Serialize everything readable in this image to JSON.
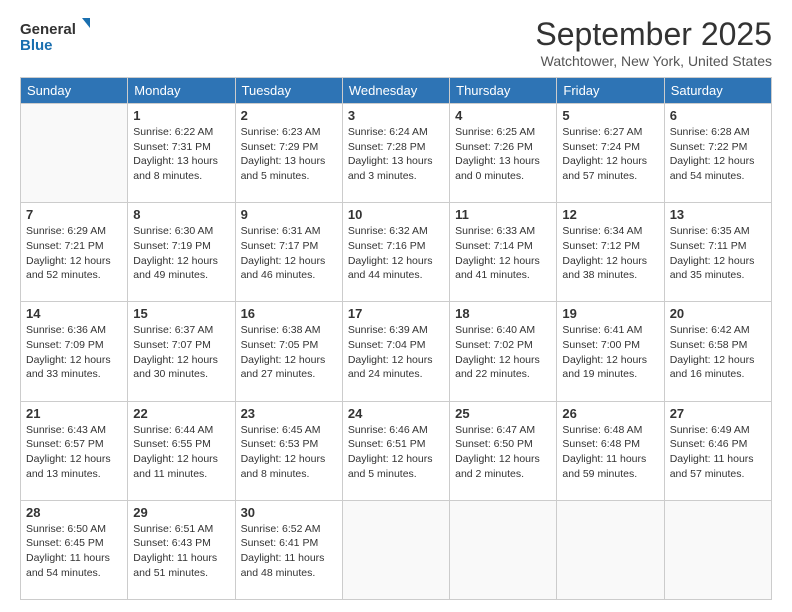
{
  "logo": {
    "general": "General",
    "blue": "Blue"
  },
  "header": {
    "month": "September 2025",
    "location": "Watchtower, New York, United States"
  },
  "weekdays": [
    "Sunday",
    "Monday",
    "Tuesday",
    "Wednesday",
    "Thursday",
    "Friday",
    "Saturday"
  ],
  "weeks": [
    [
      {
        "day": "",
        "info": ""
      },
      {
        "day": "1",
        "info": "Sunrise: 6:22 AM\nSunset: 7:31 PM\nDaylight: 13 hours\nand 8 minutes."
      },
      {
        "day": "2",
        "info": "Sunrise: 6:23 AM\nSunset: 7:29 PM\nDaylight: 13 hours\nand 5 minutes."
      },
      {
        "day": "3",
        "info": "Sunrise: 6:24 AM\nSunset: 7:28 PM\nDaylight: 13 hours\nand 3 minutes."
      },
      {
        "day": "4",
        "info": "Sunrise: 6:25 AM\nSunset: 7:26 PM\nDaylight: 13 hours\nand 0 minutes."
      },
      {
        "day": "5",
        "info": "Sunrise: 6:27 AM\nSunset: 7:24 PM\nDaylight: 12 hours\nand 57 minutes."
      },
      {
        "day": "6",
        "info": "Sunrise: 6:28 AM\nSunset: 7:22 PM\nDaylight: 12 hours\nand 54 minutes."
      }
    ],
    [
      {
        "day": "7",
        "info": "Sunrise: 6:29 AM\nSunset: 7:21 PM\nDaylight: 12 hours\nand 52 minutes."
      },
      {
        "day": "8",
        "info": "Sunrise: 6:30 AM\nSunset: 7:19 PM\nDaylight: 12 hours\nand 49 minutes."
      },
      {
        "day": "9",
        "info": "Sunrise: 6:31 AM\nSunset: 7:17 PM\nDaylight: 12 hours\nand 46 minutes."
      },
      {
        "day": "10",
        "info": "Sunrise: 6:32 AM\nSunset: 7:16 PM\nDaylight: 12 hours\nand 44 minutes."
      },
      {
        "day": "11",
        "info": "Sunrise: 6:33 AM\nSunset: 7:14 PM\nDaylight: 12 hours\nand 41 minutes."
      },
      {
        "day": "12",
        "info": "Sunrise: 6:34 AM\nSunset: 7:12 PM\nDaylight: 12 hours\nand 38 minutes."
      },
      {
        "day": "13",
        "info": "Sunrise: 6:35 AM\nSunset: 7:11 PM\nDaylight: 12 hours\nand 35 minutes."
      }
    ],
    [
      {
        "day": "14",
        "info": "Sunrise: 6:36 AM\nSunset: 7:09 PM\nDaylight: 12 hours\nand 33 minutes."
      },
      {
        "day": "15",
        "info": "Sunrise: 6:37 AM\nSunset: 7:07 PM\nDaylight: 12 hours\nand 30 minutes."
      },
      {
        "day": "16",
        "info": "Sunrise: 6:38 AM\nSunset: 7:05 PM\nDaylight: 12 hours\nand 27 minutes."
      },
      {
        "day": "17",
        "info": "Sunrise: 6:39 AM\nSunset: 7:04 PM\nDaylight: 12 hours\nand 24 minutes."
      },
      {
        "day": "18",
        "info": "Sunrise: 6:40 AM\nSunset: 7:02 PM\nDaylight: 12 hours\nand 22 minutes."
      },
      {
        "day": "19",
        "info": "Sunrise: 6:41 AM\nSunset: 7:00 PM\nDaylight: 12 hours\nand 19 minutes."
      },
      {
        "day": "20",
        "info": "Sunrise: 6:42 AM\nSunset: 6:58 PM\nDaylight: 12 hours\nand 16 minutes."
      }
    ],
    [
      {
        "day": "21",
        "info": "Sunrise: 6:43 AM\nSunset: 6:57 PM\nDaylight: 12 hours\nand 13 minutes."
      },
      {
        "day": "22",
        "info": "Sunrise: 6:44 AM\nSunset: 6:55 PM\nDaylight: 12 hours\nand 11 minutes."
      },
      {
        "day": "23",
        "info": "Sunrise: 6:45 AM\nSunset: 6:53 PM\nDaylight: 12 hours\nand 8 minutes."
      },
      {
        "day": "24",
        "info": "Sunrise: 6:46 AM\nSunset: 6:51 PM\nDaylight: 12 hours\nand 5 minutes."
      },
      {
        "day": "25",
        "info": "Sunrise: 6:47 AM\nSunset: 6:50 PM\nDaylight: 12 hours\nand 2 minutes."
      },
      {
        "day": "26",
        "info": "Sunrise: 6:48 AM\nSunset: 6:48 PM\nDaylight: 11 hours\nand 59 minutes."
      },
      {
        "day": "27",
        "info": "Sunrise: 6:49 AM\nSunset: 6:46 PM\nDaylight: 11 hours\nand 57 minutes."
      }
    ],
    [
      {
        "day": "28",
        "info": "Sunrise: 6:50 AM\nSunset: 6:45 PM\nDaylight: 11 hours\nand 54 minutes."
      },
      {
        "day": "29",
        "info": "Sunrise: 6:51 AM\nSunset: 6:43 PM\nDaylight: 11 hours\nand 51 minutes."
      },
      {
        "day": "30",
        "info": "Sunrise: 6:52 AM\nSunset: 6:41 PM\nDaylight: 11 hours\nand 48 minutes."
      },
      {
        "day": "",
        "info": ""
      },
      {
        "day": "",
        "info": ""
      },
      {
        "day": "",
        "info": ""
      },
      {
        "day": "",
        "info": ""
      }
    ]
  ]
}
